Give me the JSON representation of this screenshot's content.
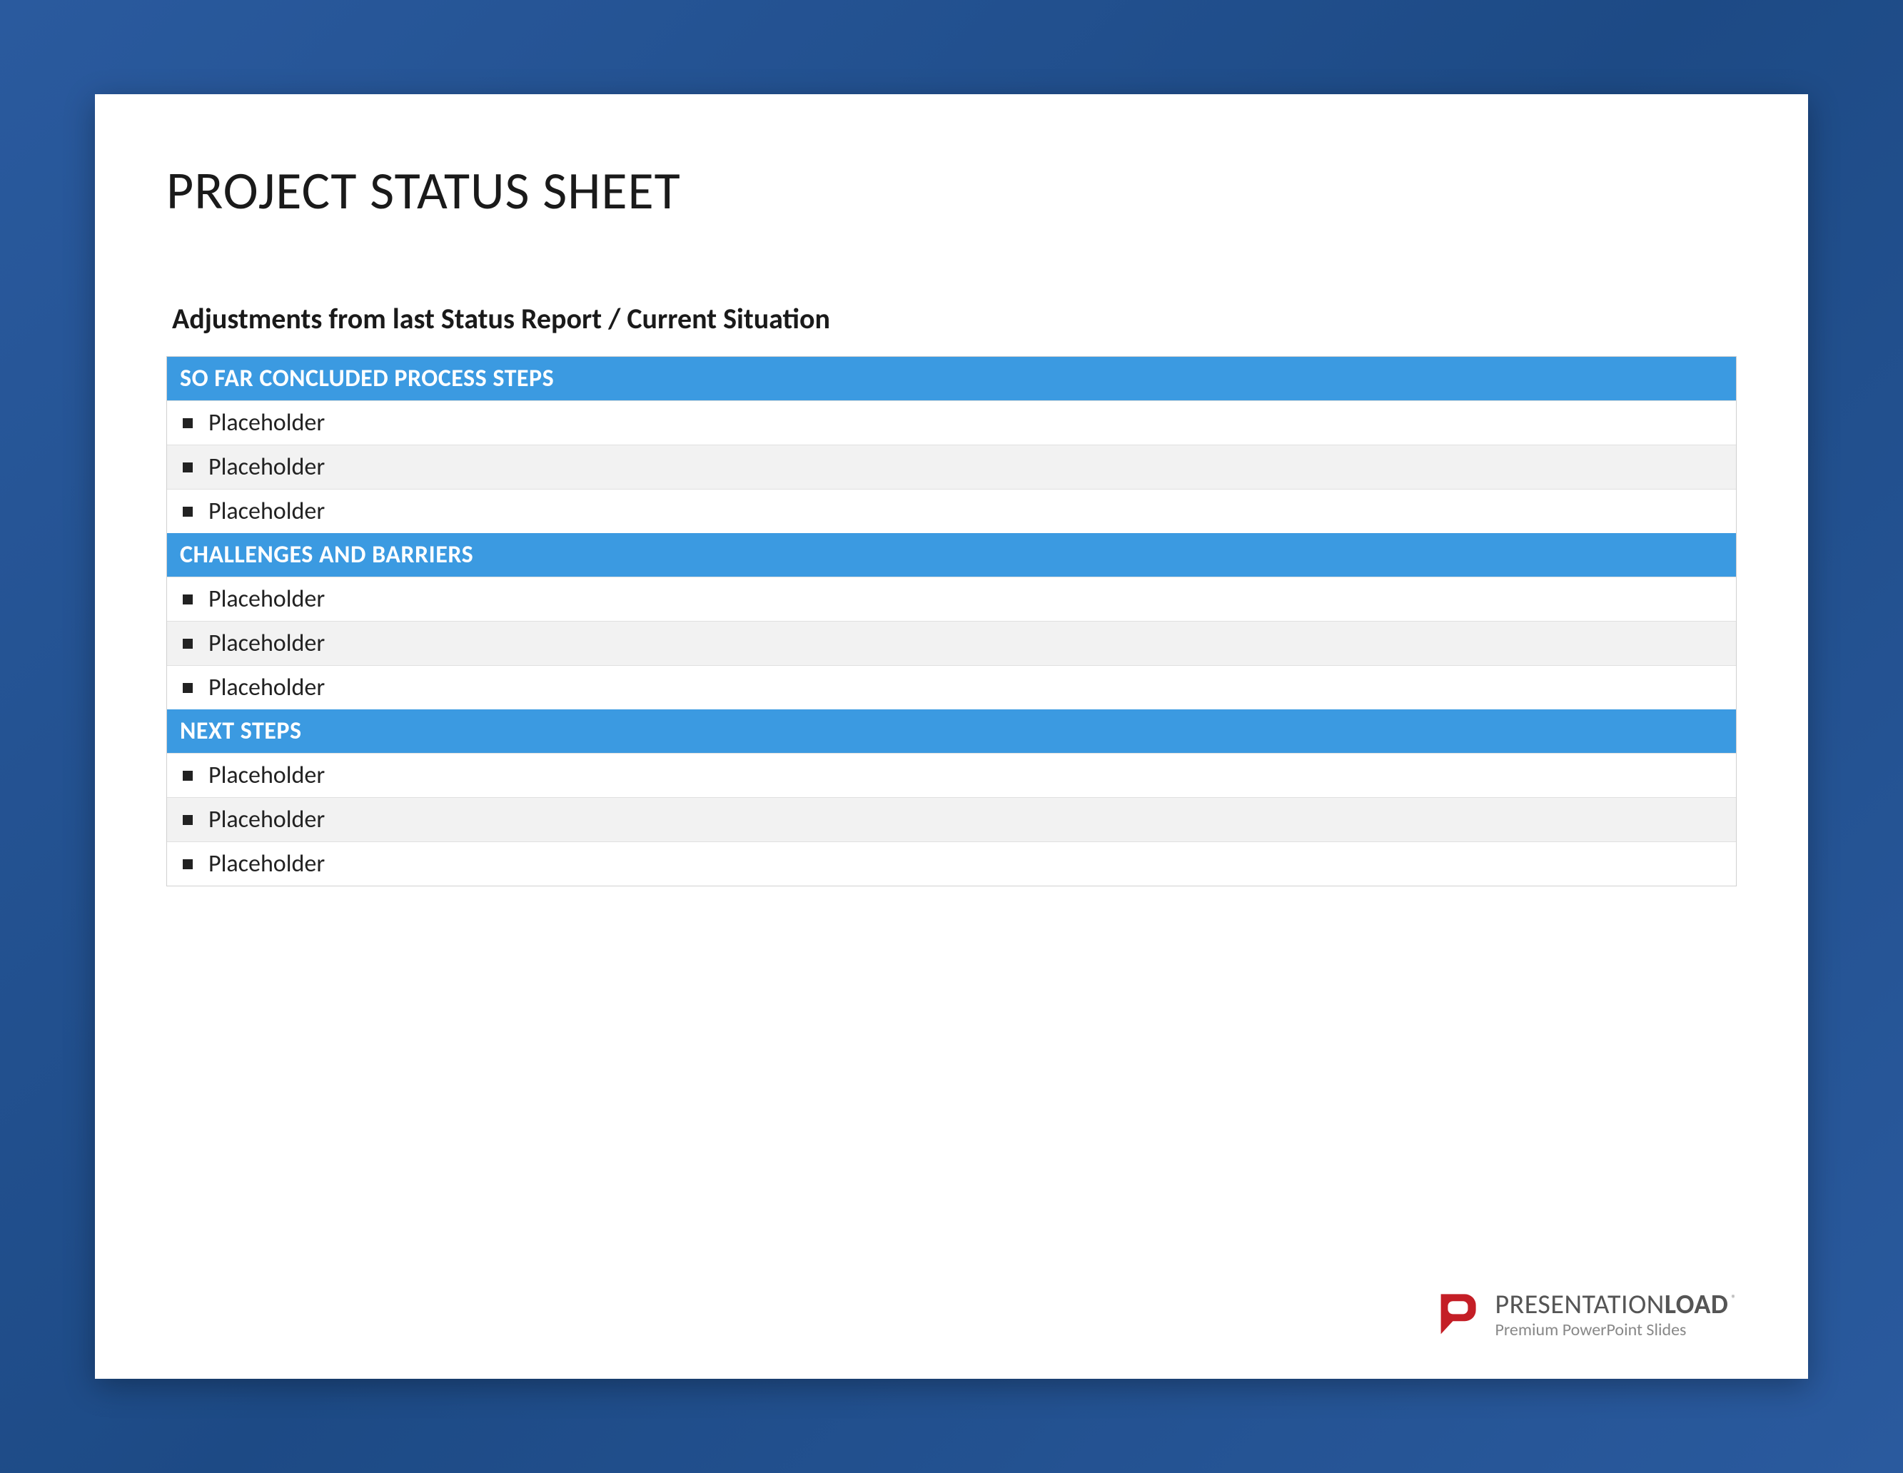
{
  "slide": {
    "title": "PROJECT STATUS SHEET",
    "subtitle": "Adjustments from last Status Report / Current Situation",
    "sections": [
      {
        "header": "SO FAR CONCLUDED PROCESS STEPS",
        "rows": [
          "Placeholder",
          "Placeholder",
          "Placeholder"
        ]
      },
      {
        "header": "CHALLENGES AND BARRIERS",
        "rows": [
          "Placeholder",
          "Placeholder",
          "Placeholder"
        ]
      },
      {
        "header": "NEXT STEPS",
        "rows": [
          "Placeholder",
          "Placeholder",
          "Placeholder"
        ]
      }
    ]
  },
  "branding": {
    "name_part1": "PRESENTATION",
    "name_part2": "LOAD",
    "registered": "®",
    "tagline": "Premium PowerPoint Slides"
  },
  "colors": {
    "section_header_bg": "#3b9ae1",
    "page_bg_gradient_from": "#2a5a9e",
    "page_bg_gradient_to": "#1d4a85",
    "logo_red": "#c41e26"
  }
}
